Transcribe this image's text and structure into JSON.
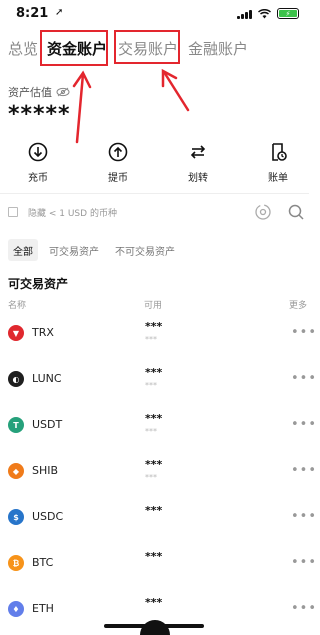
{
  "status": {
    "time": "8:21",
    "battery": "⚡"
  },
  "tabs": [
    {
      "label": "总览"
    },
    {
      "label": "资金账户"
    },
    {
      "label": "交易账户"
    },
    {
      "label": "金融账户"
    }
  ],
  "assets": {
    "estimate_label": "资产估值",
    "estimate_value": "*****"
  },
  "actions": [
    {
      "label": "充币",
      "icon": "deposit-icon"
    },
    {
      "label": "提币",
      "icon": "withdraw-icon"
    },
    {
      "label": "划转",
      "icon": "transfer-icon"
    },
    {
      "label": "账单",
      "icon": "bill-icon"
    }
  ],
  "filter": {
    "hide_small_label": "隐藏 < 1 USD 的币种"
  },
  "chips": [
    {
      "label": "全部",
      "active": true
    },
    {
      "label": "可交易资产",
      "active": false
    },
    {
      "label": "不可交易资产",
      "active": false
    }
  ],
  "section_title": "可交易资产",
  "columns": {
    "name": "名称",
    "available": "可用",
    "more": "更多"
  },
  "rows": [
    {
      "name": "TRX",
      "amount": "***",
      "sub": "***",
      "color": "#e0282e"
    },
    {
      "name": "LUNC",
      "amount": "***",
      "sub": "***",
      "color": "#1f1f1f"
    },
    {
      "name": "USDT",
      "amount": "***",
      "sub": "***",
      "color": "#26a17b"
    },
    {
      "name": "SHIB",
      "amount": "***",
      "sub": "***",
      "color": "#f07b1a"
    },
    {
      "name": "USDC",
      "amount": "***",
      "sub": "",
      "color": "#2775ca"
    },
    {
      "name": "BTC",
      "amount": "***",
      "sub": "",
      "color": "#f7931a"
    },
    {
      "name": "ETH",
      "amount": "***",
      "sub": "",
      "color": "#627eea"
    }
  ],
  "more_glyph": "•••"
}
